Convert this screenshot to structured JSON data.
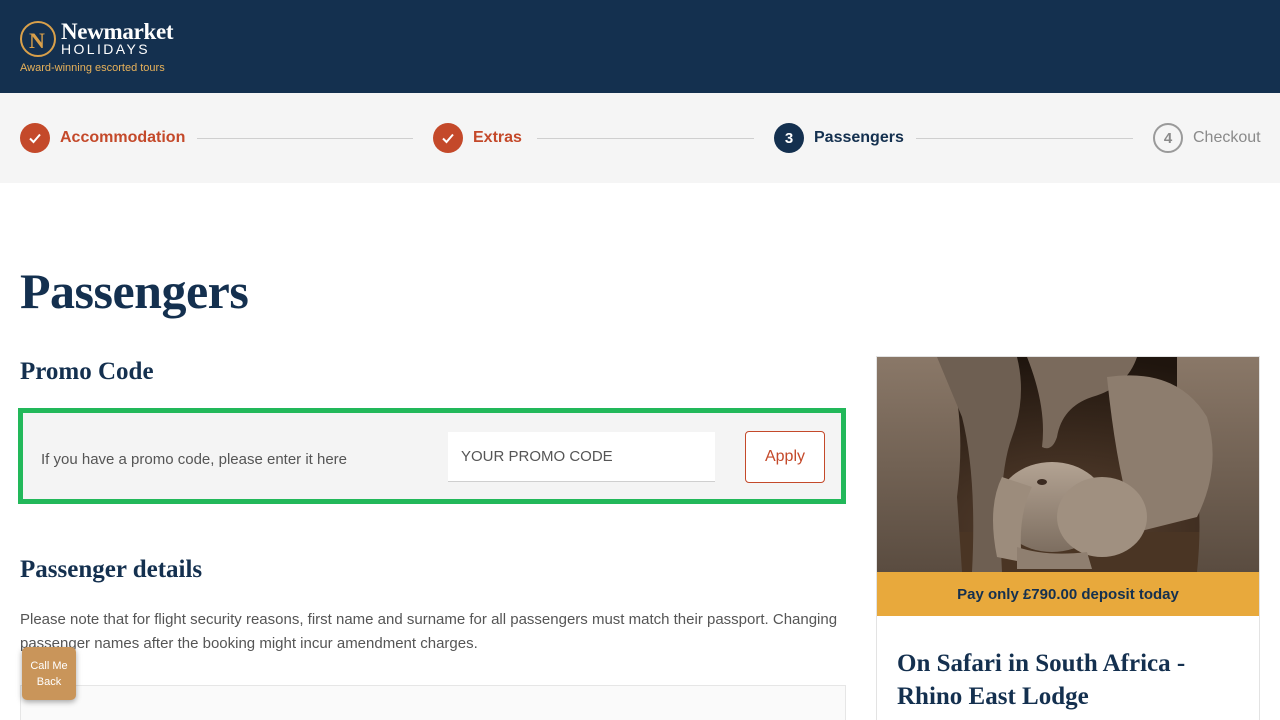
{
  "header": {
    "brand_name": "Newmarket",
    "brand_sub": "HOLIDAYS",
    "tagline": "Award-winning escorted tours",
    "logo_letter": "N",
    "colors": {
      "background": "#14304f",
      "accent": "#d9a04a"
    }
  },
  "stepper": {
    "steps": [
      {
        "number": "1",
        "label": "Accommodation",
        "state": "done"
      },
      {
        "number": "2",
        "label": "Extras",
        "state": "done"
      },
      {
        "number": "3",
        "label": "Passengers",
        "state": "current"
      },
      {
        "number": "4",
        "label": "Checkout",
        "state": "todo"
      }
    ],
    "colors": {
      "done": "#c4492a",
      "current": "#14304f",
      "todo": "#8a8a8a"
    }
  },
  "main": {
    "page_title": "Passengers",
    "promo": {
      "title": "Promo Code",
      "prompt": "If you have a promo code, please enter it here",
      "input_placeholder": "YOUR PROMO CODE",
      "input_value": "",
      "apply_label": "Apply",
      "highlight_color": "#22b85a"
    },
    "passenger_details": {
      "title": "Passenger details",
      "note": "Please note that for flight security reasons, first name and surname for all passengers must match their passport. Changing passenger names after the booking might incur amendment charges."
    },
    "callback_label": "Call Me Back"
  },
  "sidebar": {
    "image_icon": "elephants-photo",
    "deposit_text": "Pay only £790.00 deposit today",
    "tour_title": "On Safari in South Africa - Rhino East Lodge",
    "colors": {
      "deposit_bg": "#e8a93c"
    }
  }
}
